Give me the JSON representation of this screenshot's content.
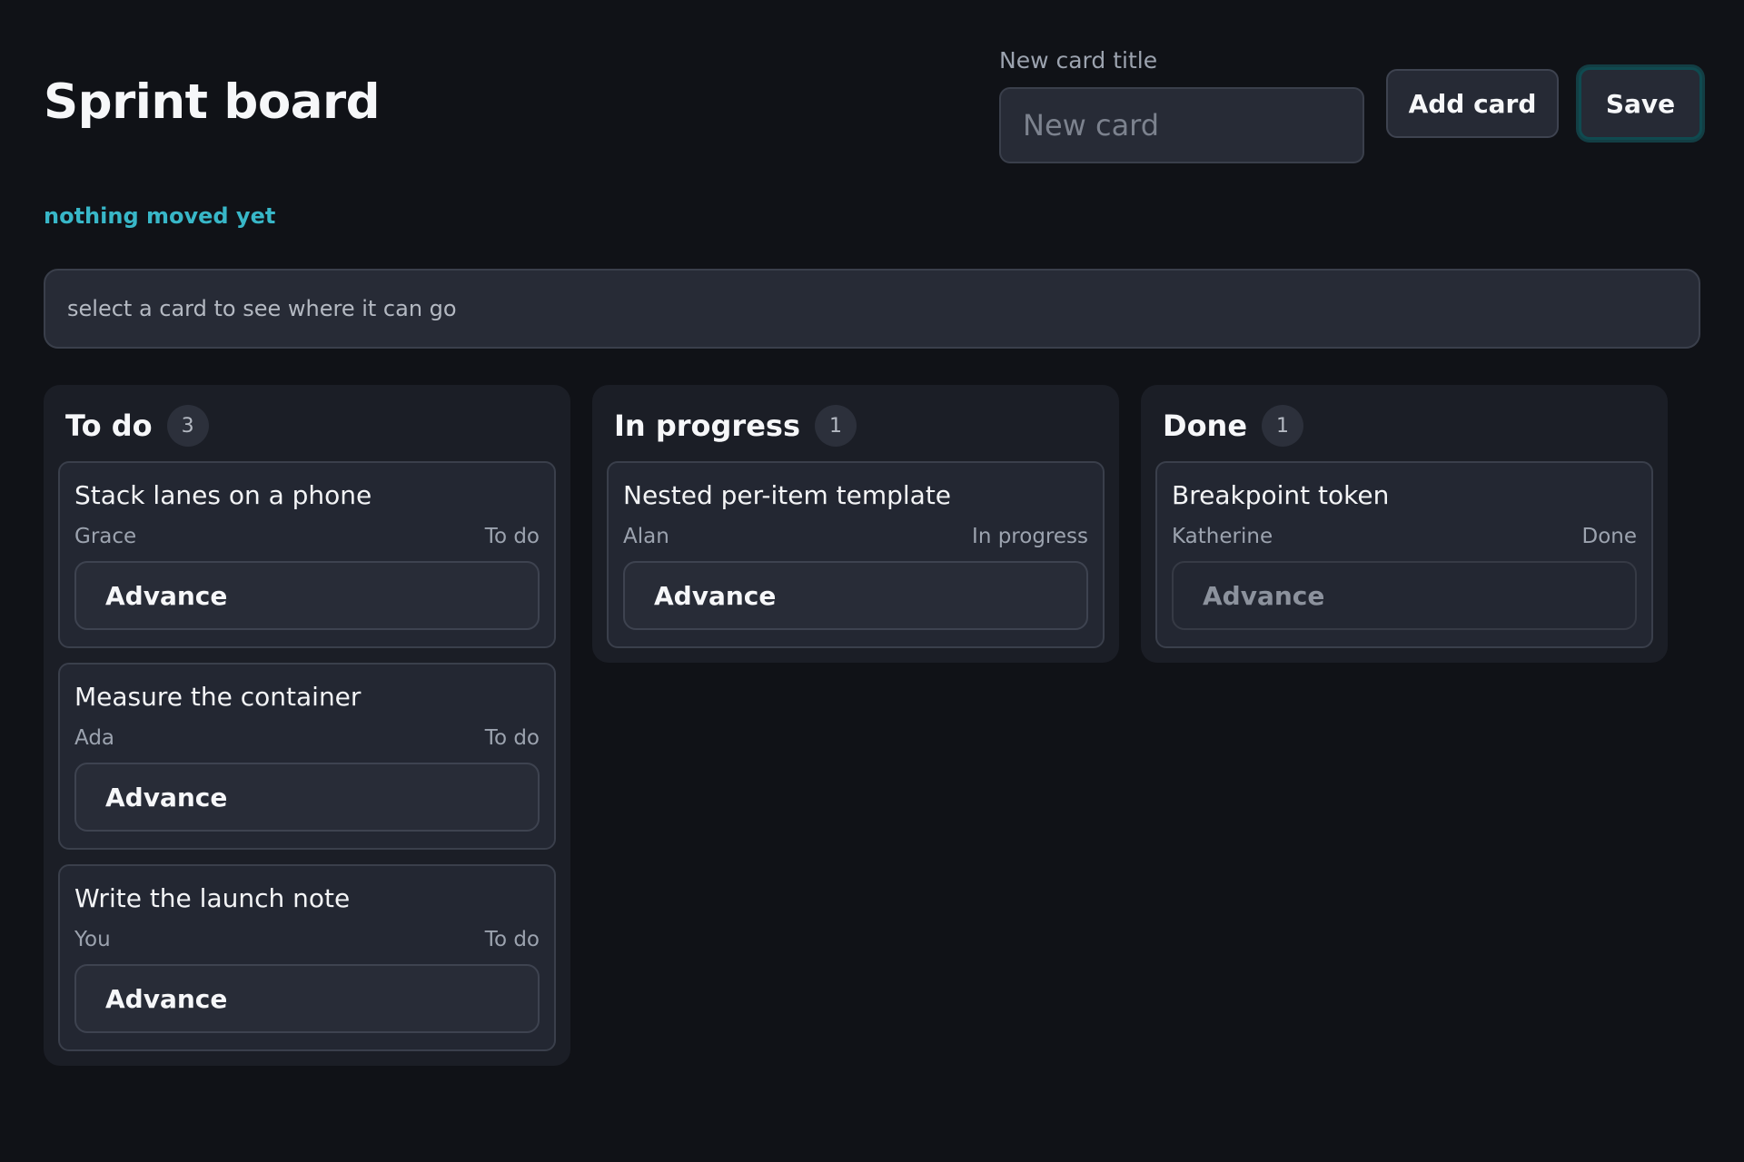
{
  "header": {
    "title": "Sprint board",
    "new_card_label": "New card title",
    "new_card_placeholder": "New card",
    "new_card_value": "",
    "add_card_label": "Add card",
    "save_label": "Save"
  },
  "status": "nothing moved yet",
  "hint": "select a card to see where it can go",
  "lanes": [
    {
      "title": "To do",
      "count": "3",
      "cards": [
        {
          "title": "Stack lanes on a phone",
          "assignee": "Grace",
          "status": "To do",
          "action": "Advance",
          "enabled": true
        },
        {
          "title": "Measure the container",
          "assignee": "Ada",
          "status": "To do",
          "action": "Advance",
          "enabled": true
        },
        {
          "title": "Write the launch note",
          "assignee": "You",
          "status": "To do",
          "action": "Advance",
          "enabled": true
        }
      ]
    },
    {
      "title": "In progress",
      "count": "1",
      "cards": [
        {
          "title": "Nested per-item template",
          "assignee": "Alan",
          "status": "In progress",
          "action": "Advance",
          "enabled": true
        }
      ]
    },
    {
      "title": "Done",
      "count": "1",
      "cards": [
        {
          "title": "Breakpoint token",
          "assignee": "Katherine",
          "status": "Done",
          "action": "Advance",
          "enabled": false
        }
      ]
    }
  ],
  "colors": {
    "background": "#101217",
    "accent": "#38b7c8",
    "lane": "#1b1e26",
    "card": "#232732"
  }
}
